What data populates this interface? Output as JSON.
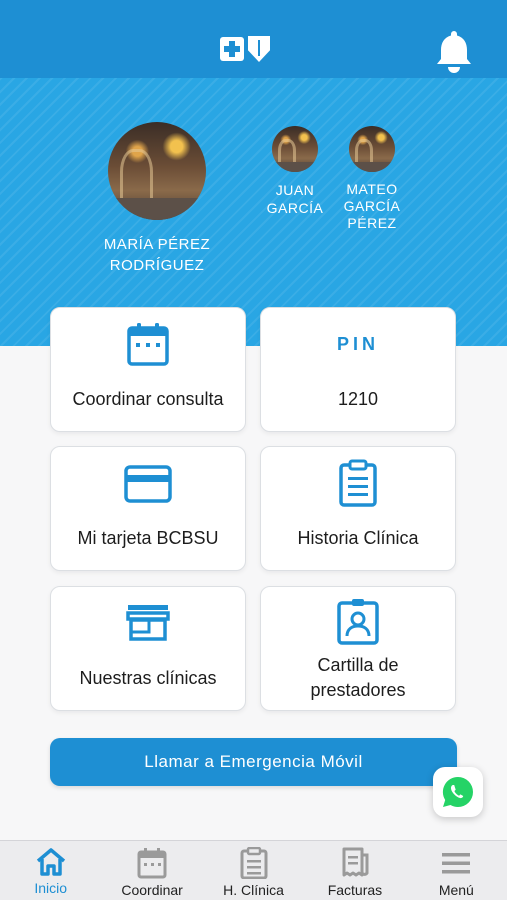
{
  "header": {
    "logo_icon": "bcbs-cross-shield-icon",
    "bell_icon": "bell-icon"
  },
  "members": [
    {
      "name": "MARÍA PÉREZ RODRÍGUEZ",
      "name_lines": [
        "MARÍA PÉREZ",
        "RODRÍGUEZ"
      ]
    },
    {
      "name": "JUAN GARCÍA",
      "name_lines": [
        "JUAN",
        "GARCÍA"
      ]
    },
    {
      "name": "MATEO GARCÍA PÉREZ",
      "name_lines": [
        "MATEO",
        "GARCÍA",
        "PÉREZ"
      ]
    }
  ],
  "cards": {
    "coordinar": {
      "label": "Coordinar consulta",
      "icon": "calendar-icon"
    },
    "pin": {
      "title": "PIN",
      "value": "1210"
    },
    "tarjeta": {
      "label": "Mi tarjeta BCBSU",
      "icon": "credit-card-icon"
    },
    "historia": {
      "label": "Historia Clínica",
      "icon": "clipboard-icon"
    },
    "clinicas": {
      "label": "Nuestras clínicas",
      "icon": "storefront-icon"
    },
    "cartilla": {
      "label_lines": [
        "Cartilla de",
        "prestadores"
      ],
      "icon": "id-badge-icon"
    }
  },
  "emergency_button": {
    "label": "Llamar a Emergencia Móvil"
  },
  "whatsapp": {
    "icon": "whatsapp-icon"
  },
  "bottom_nav": [
    {
      "label": "Inicio",
      "icon": "home-icon",
      "active": true
    },
    {
      "label": "Coordinar",
      "icon": "calendar-icon",
      "active": false
    },
    {
      "label": "H. Clínica",
      "icon": "clipboard-icon",
      "active": false
    },
    {
      "label": "Facturas",
      "icon": "receipt-icon",
      "active": false
    },
    {
      "label": "Menú",
      "icon": "hamburger-icon",
      "active": false
    }
  ],
  "colors": {
    "primary": "#1e8fd3",
    "hero": "#29a6e4",
    "whatsapp": "#25d366",
    "nav_inactive": "#9a9a9a"
  }
}
